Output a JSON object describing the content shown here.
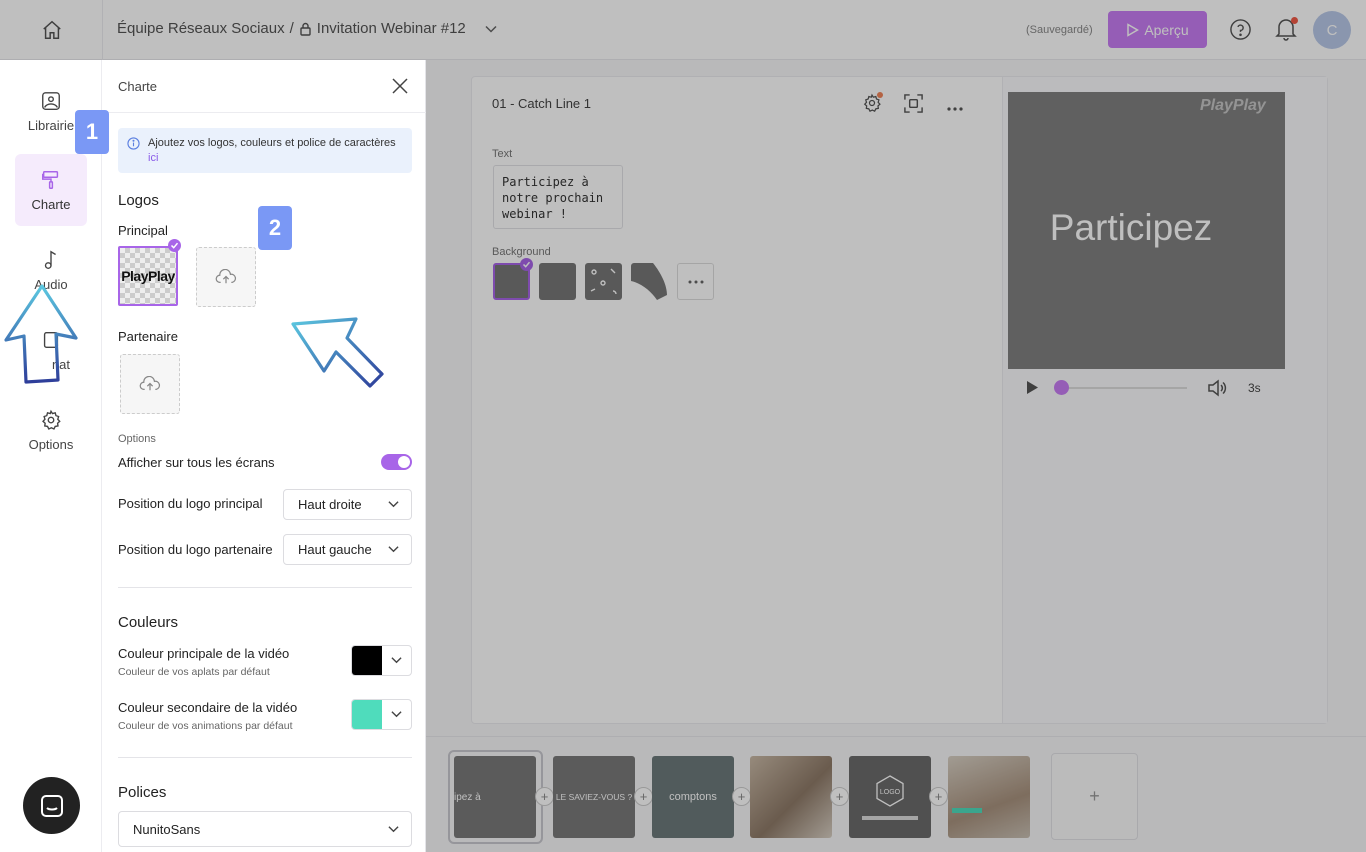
{
  "topbar": {
    "breadcrumb_team": "Équipe Réseaux Sociaux",
    "breadcrumb_sep": "/",
    "project_title": "Invitation Webinar #12",
    "saved_status": "(Sauvegardé)",
    "preview_label": "Aperçu",
    "avatar_initial": "C",
    "brand_color": "#c77df3"
  },
  "rail": {
    "items": [
      {
        "label": "Librairie",
        "icon": "image-icon"
      },
      {
        "label": "Charte",
        "icon": "paint-roller-icon"
      },
      {
        "label": "Audio",
        "icon": "music-note-icon"
      },
      {
        "label": "nat",
        "icon": "format-icon"
      },
      {
        "label": "Options",
        "icon": "gear-icon"
      }
    ]
  },
  "panel": {
    "title": "Charte",
    "info_text": "Ajoutez vos logos, couleurs et police de caractères",
    "info_link": "ici",
    "logos_title": "Logos",
    "principal_label": "Principal",
    "principal_logo_text": "PlayPlay",
    "partenaire_label": "Partenaire",
    "options_label": "Options",
    "show_all_label": "Afficher sur tous les écrans",
    "show_all_on": true,
    "pos_principal_label": "Position du logo principal",
    "pos_principal_value": "Haut droite",
    "pos_partenaire_label": "Position du logo partenaire",
    "pos_partenaire_value": "Haut gauche",
    "couleurs_title": "Couleurs",
    "primary_color_title": "Couleur principale de la vidéo",
    "primary_color_sub": "Couleur de vos aplats par défaut",
    "primary_color": "#000000",
    "secondary_color_title": "Couleur secondaire de la vidéo",
    "secondary_color_sub": "Couleur de vos animations par défaut",
    "secondary_color": "#4fdcbc",
    "polices_title": "Polices",
    "font_value": "NunitoSans"
  },
  "editor": {
    "scene_title": "01 - Catch Line 1",
    "text_label": "Text",
    "text_value": "Participez à\nnotre prochain\nwebinar !",
    "background_label": "Background",
    "preview_text": "Participez",
    "preview_watermark": "PlayPlay",
    "duration": "3s"
  },
  "timeline": {
    "slides": [
      {
        "label": "ipez à"
      },
      {
        "label": "LE SAVIEZ-VOUS ?"
      },
      {
        "label": "comptons"
      },
      {
        "label": ""
      },
      {
        "label": "LOGO"
      },
      {
        "label": ""
      }
    ],
    "add_label": "+"
  },
  "annotations": {
    "step1": "1",
    "step2": "2"
  }
}
